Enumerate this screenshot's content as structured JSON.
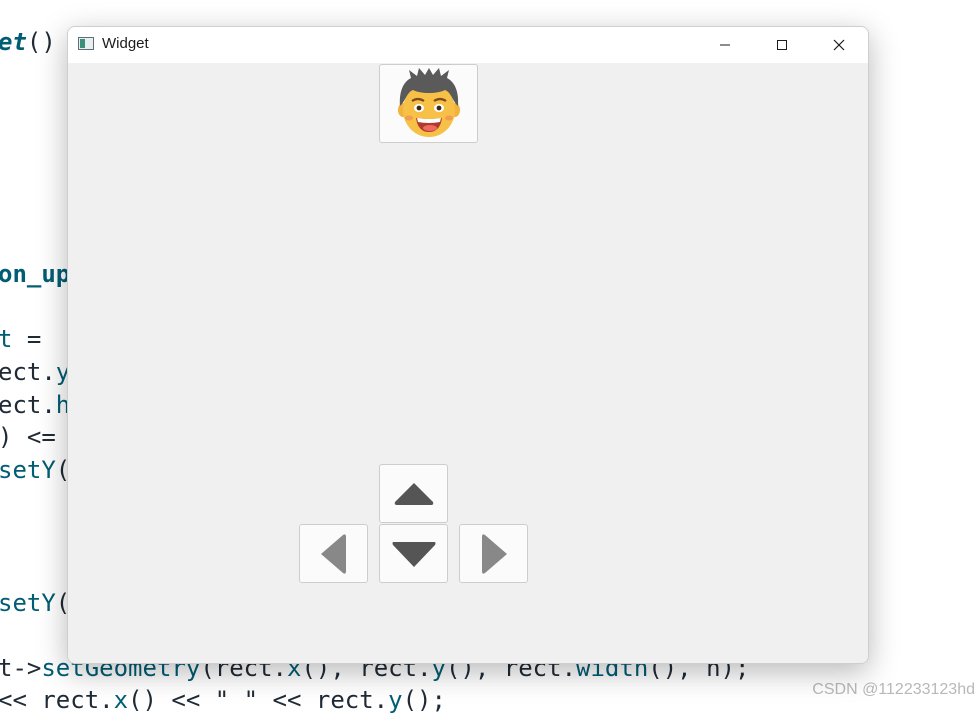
{
  "window": {
    "title": "Widget",
    "controls": {
      "minimize_icon": "minimize-icon",
      "maximize_icon": "maximize-icon",
      "close_icon": "close-icon"
    }
  },
  "avatar": {
    "icon": "smiling-boy-face-icon"
  },
  "dpad": {
    "up_icon": "arrow-up-icon",
    "left_icon": "arrow-left-icon",
    "down_icon": "arrow-down-icon",
    "right_icon": "arrow-right-icon"
  },
  "background_code": {
    "line_1": "et()",
    "line_2": "on_up",
    "line_3": "t =",
    "line_4": "ect.y",
    "line_5": "ect.h",
    "line_6": ") <=",
    "line_7": "setY(",
    "line_8": "setY(",
    "line_9": "t->setGeometry(rect.x(), rect.y(), rect.width(), h);",
    "line_10": "<< rect.x() << \" \" << rect.y();"
  },
  "watermark": "CSDN @112233123hd",
  "colors": {
    "window_bg": "#f0f0f0",
    "titlebar_bg": "#ffffff",
    "arrow_dark": "#555555",
    "arrow_mid": "#888888",
    "code_keyword": "#005d74"
  }
}
